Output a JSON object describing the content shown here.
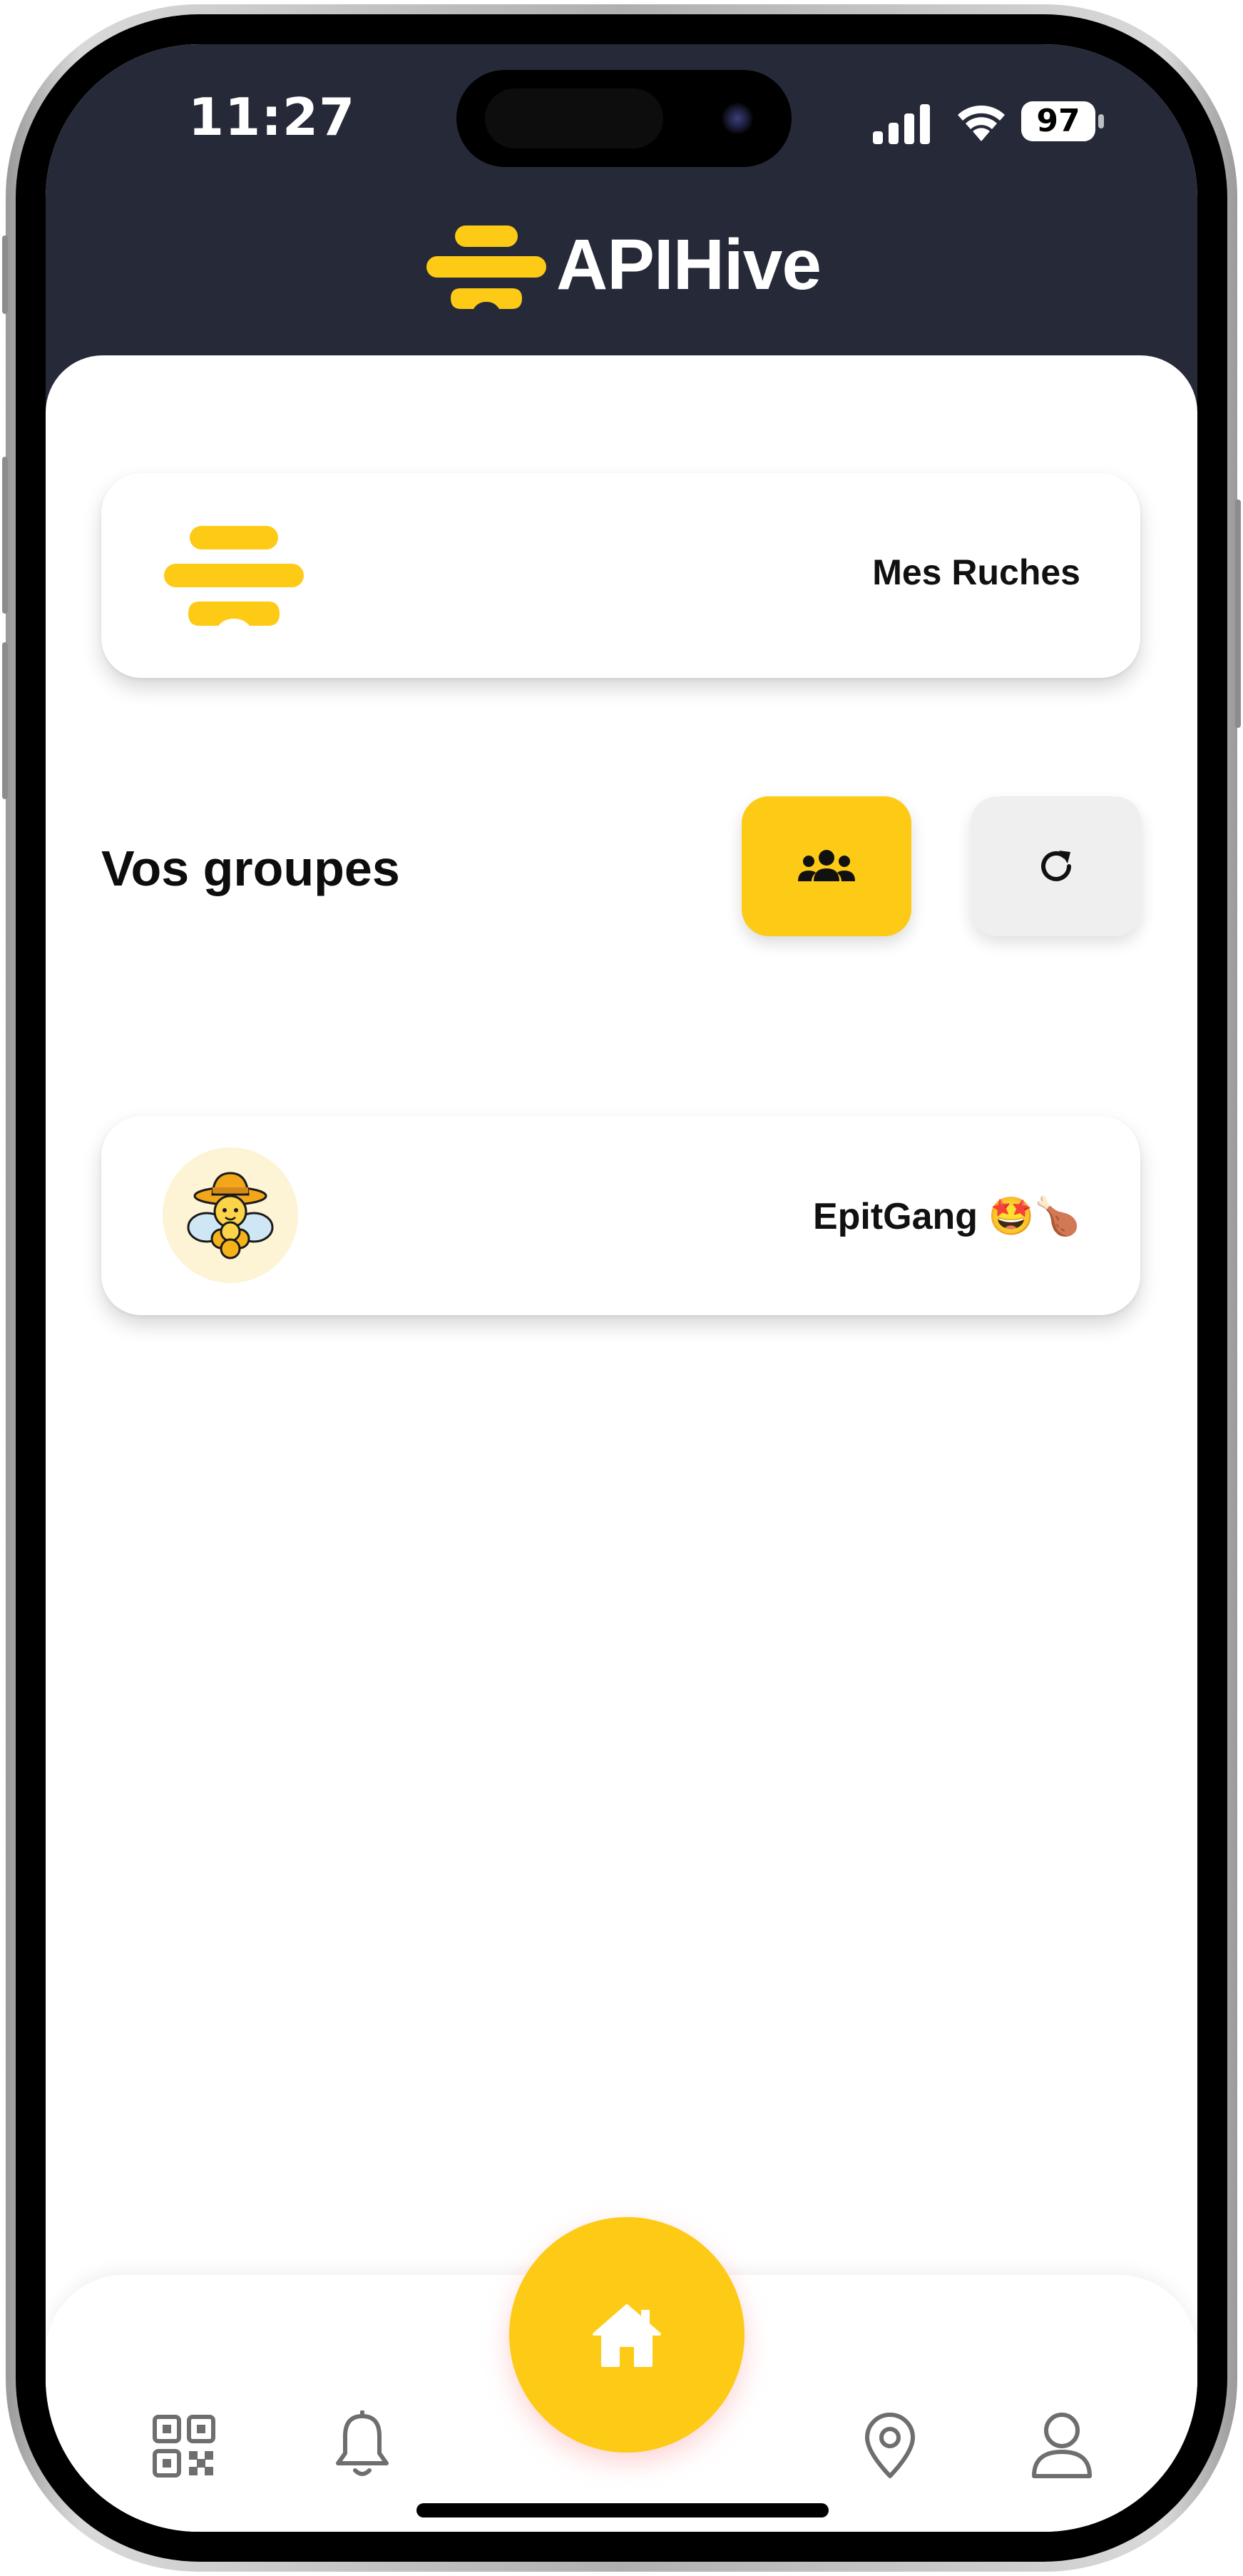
{
  "status_bar": {
    "time": "11:27",
    "battery": "97"
  },
  "header": {
    "app_title": "APIHive"
  },
  "ruches_card": {
    "label": "Mes Ruches"
  },
  "groups": {
    "heading": "Vos groupes",
    "items": [
      {
        "name": "EpitGang 🤩🍗",
        "avatar": "🧑‍🌾🐝"
      }
    ]
  },
  "bottom_nav": {
    "items": [
      "qr-code-icon",
      "bell-icon",
      "home-icon",
      "map-pin-icon",
      "user-icon"
    ],
    "active": "home-icon"
  },
  "colors": {
    "accent": "#fdca15",
    "header_bg": "#262a38",
    "icon_gray": "#6e6e6e"
  }
}
